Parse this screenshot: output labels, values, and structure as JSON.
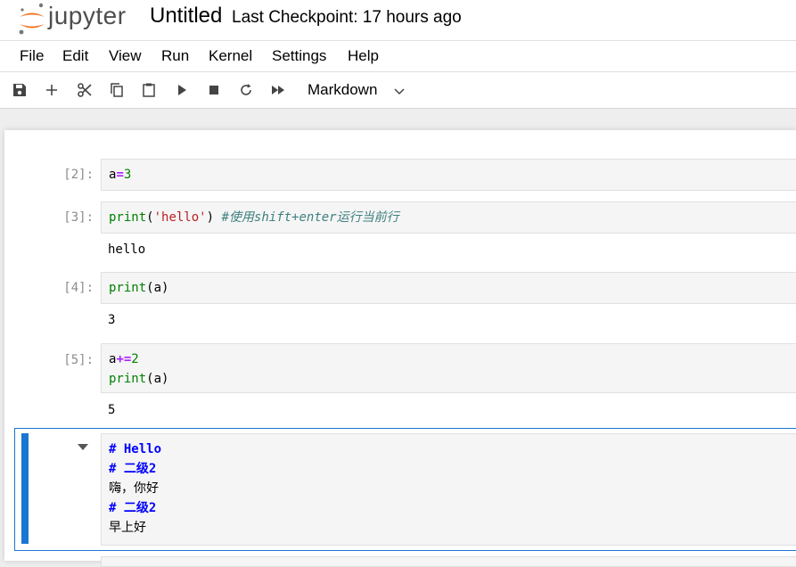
{
  "header": {
    "logo_text": "jupyter",
    "notebook_title": "Untitled",
    "checkpoint": "Last Checkpoint: 17 hours ago"
  },
  "menu": [
    "File",
    "Edit",
    "View",
    "Run",
    "Kernel",
    "Settings",
    "Help"
  ],
  "toolbar": {
    "buttons": [
      "save-icon",
      "add-icon",
      "cut-icon",
      "copy-icon",
      "paste-icon",
      "run-icon",
      "stop-icon",
      "restart-icon",
      "fast-forward-icon"
    ],
    "cell_type": "Markdown"
  },
  "cells": [
    {
      "prompt": "[2]:",
      "code": "a=3",
      "output": ""
    },
    {
      "prompt": "[3]:",
      "code": "print('hello') #使用shift+enter运行当前行",
      "output": "hello"
    },
    {
      "prompt": "[4]:",
      "code": "print(a)",
      "output": "3"
    },
    {
      "prompt": "[5]:",
      "code": "a+=2\nprint(a)",
      "output": "5"
    }
  ],
  "markdown_cell": {
    "lines": [
      "# Hello",
      "# 二级2",
      "嗨，你好",
      "# 二级2",
      "早上好"
    ]
  },
  "colors": {
    "accent": "#1976d2",
    "logo_orange": "#f37626"
  }
}
